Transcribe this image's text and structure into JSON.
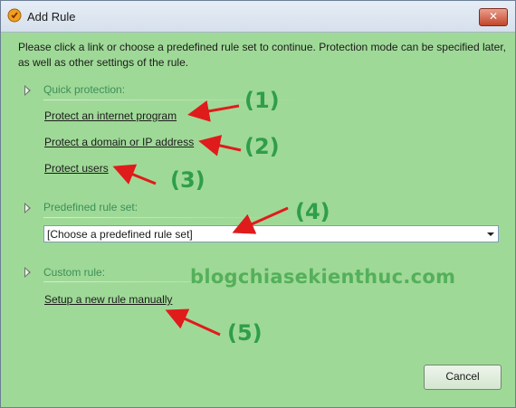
{
  "window": {
    "title": "Add Rule",
    "close_glyph": "✕",
    "icon": "app-shield-icon"
  },
  "intro_text": "Please click a link or choose a predefined rule set to continue. Protection mode can be specified later, as well as other settings of the rule.",
  "sections": {
    "quick": {
      "heading": "Quick protection:",
      "links": [
        "Protect an internet program",
        "Protect a domain or IP address",
        "Protect users"
      ]
    },
    "predefined": {
      "heading": "Predefined rule set:",
      "dropdown_value": "[Choose a predefined rule set]"
    },
    "custom": {
      "heading": "Custom rule:",
      "link": "Setup a new rule manually"
    }
  },
  "watermark": "blogchiasekienthuc.com",
  "buttons": {
    "cancel": "Cancel"
  },
  "annotations": [
    "(1)",
    "(2)",
    "(3)",
    "(4)",
    "(5)"
  ],
  "colors": {
    "background": "#9fd997",
    "heading": "#3c8f58",
    "annotation": "#2f9e4b",
    "arrow": "#e01b1b"
  }
}
